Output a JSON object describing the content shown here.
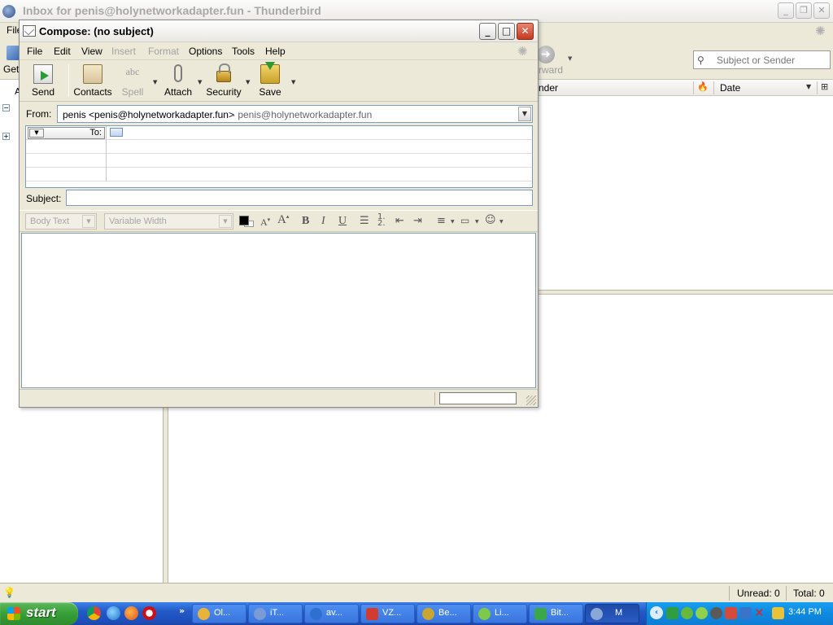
{
  "main_window": {
    "title": "Inbox for penis@holynetworkadapter.fun - Thunderbird",
    "menu_file": "File",
    "toolbar_get_label": "Get",
    "toolbar_forward_label": "rward",
    "search_placeholder": "Subject or Sender",
    "folder_col_label": "A",
    "thread_columns": {
      "sender": "nder",
      "date": "Date"
    },
    "status": {
      "unread": "Unread: 0",
      "total": "Total: 0"
    }
  },
  "compose": {
    "title": "Compose: (no subject)",
    "menu": [
      "File",
      "Edit",
      "View",
      "Insert",
      "Format",
      "Options",
      "Tools",
      "Help"
    ],
    "toolbar": {
      "send": "Send",
      "contacts": "Contacts",
      "spell": "Spell",
      "spell_icon_text": "abc",
      "attach": "Attach",
      "security": "Security",
      "save": "Save"
    },
    "from_label": "From:",
    "from_identity": "penis <penis@holynetworkadapter.fun>",
    "from_account": "- penis@holynetworkadapter.fun",
    "address_type": "To:",
    "address_value": "",
    "subject_label": "Subject:",
    "subject_value": "",
    "format": {
      "paragraph_style": "Body Text",
      "font": "Variable Width"
    },
    "body_text": ""
  },
  "taskbar": {
    "start_label": "start",
    "tasks": [
      {
        "label": "Ol...",
        "icon": "chrome-icon",
        "color": "#e8b33a"
      },
      {
        "label": "iT...",
        "icon": "itunes-icon",
        "color": "#7a9bd6"
      },
      {
        "label": "av...",
        "icon": "skype-icon",
        "color": "#2f6fd0"
      },
      {
        "label": "VZ...",
        "icon": "vz-icon",
        "color": "#d23b2f"
      },
      {
        "label": "Be...",
        "icon": "be-icon",
        "color": "#c9a531"
      },
      {
        "label": "Li...",
        "icon": "li-icon",
        "color": "#7ec84a"
      },
      {
        "label": "Bit...",
        "icon": "bittorrent-icon",
        "color": "#3aa84a"
      },
      {
        "label": "M",
        "icon": "thunderbird-icon",
        "color": "#8aa7d8"
      }
    ],
    "clock": "3:44 PM"
  }
}
